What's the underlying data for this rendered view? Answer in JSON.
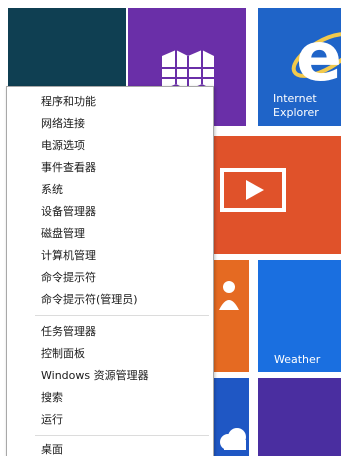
{
  "tiles": {
    "ie_label": "Internet\nExplorer",
    "weather_label": "Weather"
  },
  "colors": {
    "dark_teal": "#0f3f52",
    "purple": "#6a2fa8",
    "blue": "#1f64c8",
    "orange_red": "#e0522a",
    "orange": "#e56a22",
    "weather_blue": "#1a6fe0",
    "dark_purple": "#4a2ea0",
    "mid_blue": "#1f57c4"
  },
  "menu": {
    "items": [
      "程序和功能",
      "网络连接",
      "电源选项",
      "事件查看器",
      "系统",
      "设备管理器",
      "磁盘管理",
      "计算机管理",
      "命令提示符",
      "命令提示符(管理员)",
      "任务管理器",
      "控制面板",
      "Windows 资源管理器",
      "搜索",
      "运行",
      "桌面"
    ]
  }
}
